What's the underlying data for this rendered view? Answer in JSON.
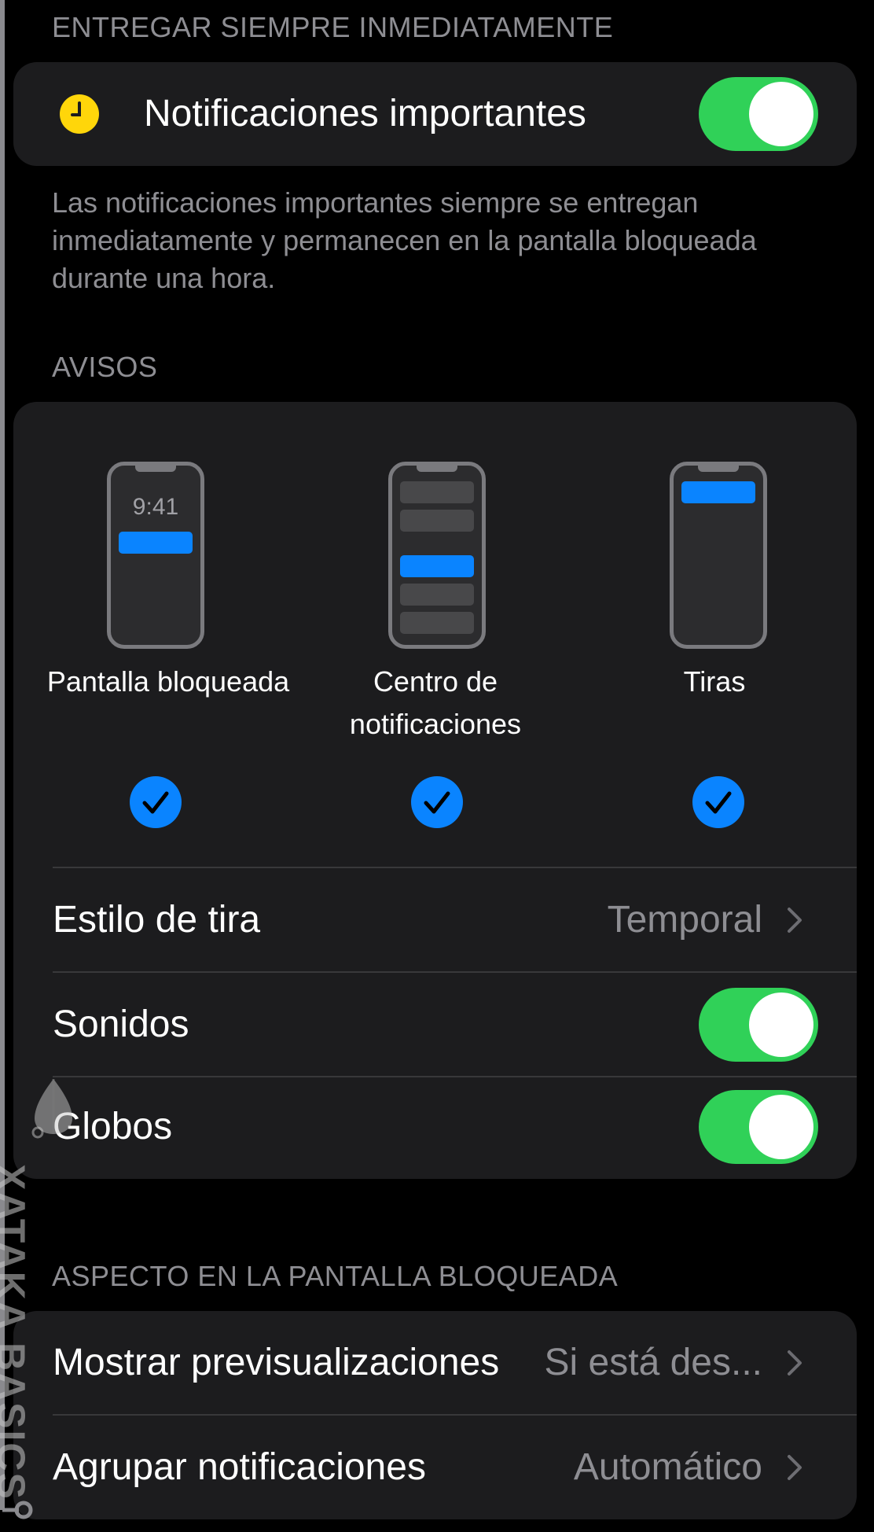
{
  "sections": {
    "deliver_header": "ENTREGAR SIEMPRE INMEDIATAMENTE",
    "important": {
      "icon": "clock-icon",
      "label": "Notificaciones importantes",
      "enabled": true
    },
    "footer": "Las notificaciones importantes siempre se entregan inmediatamente y permanecen en la pantalla bloqueada durante una hora.",
    "alerts_header": "AVISOS",
    "lock_header": "ASPECTO EN LA PANTALLA BLOQUEADA"
  },
  "alerts": {
    "options": [
      {
        "label": "Pantalla bloqueada",
        "time": "9:41",
        "checked": true
      },
      {
        "label": "Centro de\nnotificaciones",
        "checked": true
      },
      {
        "label": "Tiras",
        "checked": true
      }
    ],
    "banner_style": {
      "label": "Estilo de tira",
      "value": "Temporal"
    },
    "sounds": {
      "label": "Sonidos",
      "enabled": true
    },
    "badges": {
      "label": "Globos",
      "enabled": true
    }
  },
  "lock_screen": {
    "previews": {
      "label": "Mostrar previsualizaciones",
      "value": "Si está des..."
    },
    "grouping": {
      "label": "Agrupar notificaciones",
      "value": "Automático"
    }
  },
  "watermark": "XATAKA BASICS",
  "colors": {
    "background": "#000000",
    "card": "#1c1c1e",
    "toggle_on": "#30d158",
    "accent": "#0a84ff",
    "secondary_text": "#8e8e93",
    "clock_icon": "#ffd60a"
  }
}
